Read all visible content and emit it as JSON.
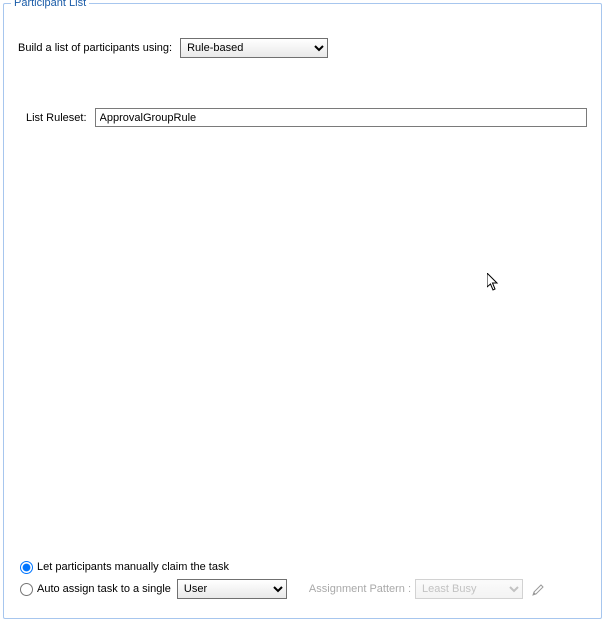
{
  "fieldset": {
    "legend": "Participant List"
  },
  "build": {
    "label": "Build a list of participants using:",
    "method": "Rule-based"
  },
  "ruleset": {
    "label": "List Ruleset:",
    "value": "ApprovalGroupRule"
  },
  "assignment": {
    "manual_label": "Let participants manually claim the task",
    "auto_label": "Auto assign task to a single",
    "auto_target": "User",
    "pattern_label": "Assignment Pattern :",
    "pattern_value": "Least Busy",
    "selected": "manual"
  }
}
